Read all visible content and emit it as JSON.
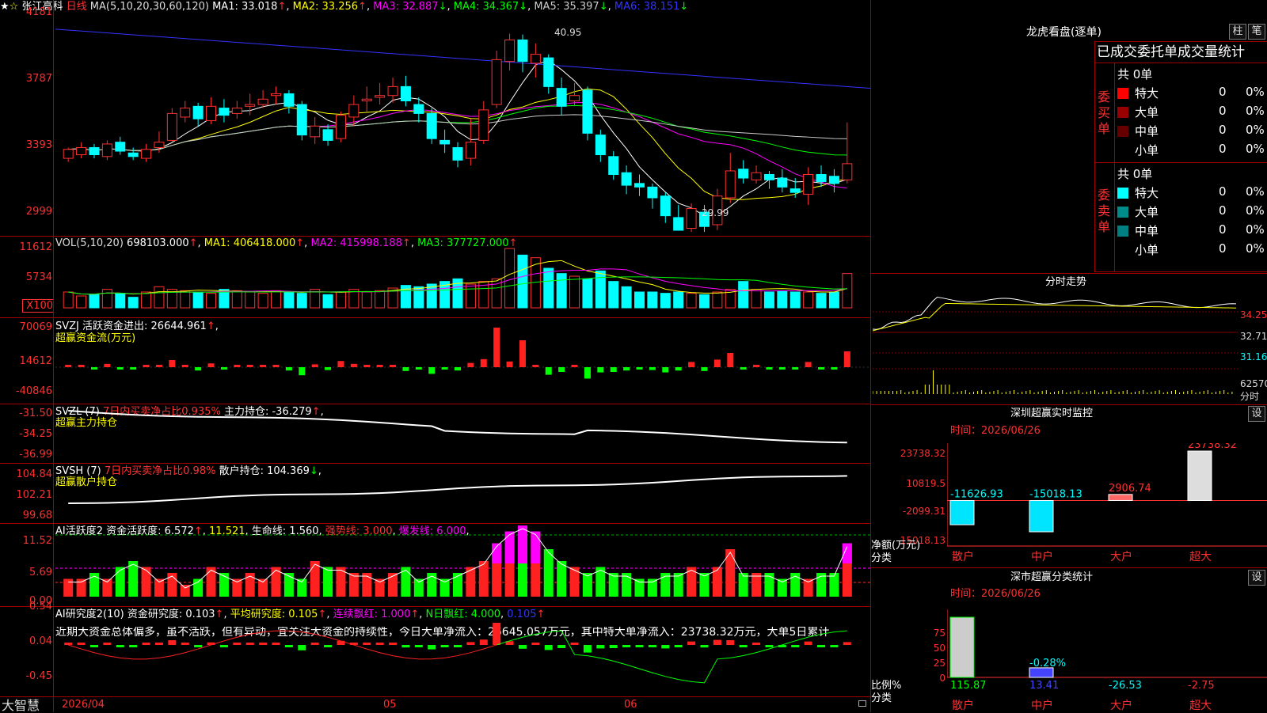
{
  "header": {
    "stock_name": "张江高科",
    "period": "日线",
    "ma_title": "MA(5,10,20,30,60,120)",
    "ma1": "MA1: 33.018",
    "ma2": "MA2: 33.256",
    "ma3": "MA3: 32.887",
    "ma4": "MA4: 34.367",
    "ma5": "MA5: 35.397",
    "ma6": "MA6: 38.151",
    "up": "↑",
    "down": "↓"
  },
  "price_axis": [
    "4181",
    "3787",
    "3393",
    "2999"
  ],
  "price_marks": {
    "high": "40.95",
    "low": "29.99"
  },
  "vol": {
    "title": "VOL(5,10,20)",
    "value": "698103.000",
    "ma1": "MA1: 406418.000",
    "ma2": "MA2: 415998.188",
    "ma3": "MA3: 377727.000",
    "axis": [
      "11612",
      "5734",
      "X100"
    ]
  },
  "svzj": {
    "line1": "SVZJ  活跃资金进出: 26644.961",
    "line2": "超赢资金流(万元)",
    "axis": [
      "70069",
      "14612",
      "-40846"
    ]
  },
  "svzl": {
    "prefix": "SVZL (7)",
    "mid": "7日内买卖净占比0.935%",
    "tail": "主力持仓: -36.279",
    "line2": "超赢主力持仓",
    "axis": [
      "-31.50",
      "-34.25",
      "-36.99"
    ]
  },
  "svsh": {
    "prefix": "SVSH (7)",
    "mid": "7日内买卖净占比0.98%",
    "tail": "散户持仓: 104.369",
    "line2": "超赢散户持仓",
    "axis": [
      "104.84",
      "102.21",
      "99.68"
    ]
  },
  "ai1": {
    "a": "AI活跃度2 资金活跃度: 6.572",
    "b": "11.521",
    "c": "生命线: 1.560",
    "d": "强势线: 3.000",
    "e": "爆发线: 6.000",
    "axis": [
      "11.52",
      "5.69",
      "0.00"
    ]
  },
  "ai2": {
    "a": "AI研究度2(10) 资金研究度: 0.103",
    "b": "平均研究度: 0.105",
    "c": "连续飘红: 1.000",
    "d": "N日飘红: 4.000",
    "e": "0.105",
    "comment": "近期大资金总体偏多，虽不活跃，但有异动，宜关注大资金的持续性，今日大单净流入：26645.057万元，其中特大单净流入：23738.32万元，大单5日累计",
    "axis": [
      "0.54",
      "0.04",
      "-0.45"
    ]
  },
  "date_axis": {
    "d1": "2026/04",
    "d2": "05",
    "d3": "06",
    "brand": "大智慧"
  },
  "right": {
    "lhkp_title": "龙虎看盘(逐单)",
    "btn1": "柱",
    "btn2": "笔",
    "stat_title": "已成交委托单成交量统计",
    "buy_label": "委买单",
    "sell_label": "委卖单",
    "buy_total": "共 0单",
    "sell_total": "共 0单",
    "buy_rows": [
      {
        "name": "特大",
        "n": "0",
        "p": "0%",
        "color": "#ff0000"
      },
      {
        "name": "大单",
        "n": "0",
        "p": "0%",
        "color": "#990000"
      },
      {
        "name": "中单",
        "n": "0",
        "p": "0%",
        "color": "#660000"
      },
      {
        "name": "小单",
        "n": "0",
        "p": "0%",
        "color": ""
      }
    ],
    "sell_rows": [
      {
        "name": "特大",
        "n": "0",
        "p": "0%",
        "color": "#00ffff"
      },
      {
        "name": "大单",
        "n": "0",
        "p": "0%",
        "color": "#008b8b"
      },
      {
        "name": "中单",
        "n": "0",
        "p": "0%",
        "color": "#008080"
      },
      {
        "name": "小单",
        "n": "0",
        "p": "0%",
        "color": ""
      }
    ],
    "intraday_title": "分时走势",
    "intraday_axis": [
      "34.25",
      "32.71",
      "31.16",
      "62570",
      "分时"
    ],
    "sz_title": "深圳超赢实时监控",
    "sz_gear": "设",
    "sz_time": "时间：2026/06/26",
    "sz_axis": [
      "23738.32",
      "10819.5",
      "-2099.31",
      "-15018.13"
    ],
    "sz_ylabel": "净额(万元)",
    "sz_xlabel": "分类",
    "sz_bars": [
      {
        "cat": "散户",
        "value": "-11626.93"
      },
      {
        "cat": "中户",
        "value": "-15018.13"
      },
      {
        "cat": "大户",
        "value": "2906.74"
      },
      {
        "cat": "超大",
        "value": "23738.32"
      }
    ],
    "cls_title": "深市超赢分类统计",
    "cls_gear": "设",
    "cls_time": "时间：2026/06/26",
    "cls_axis": [
      "75",
      "50",
      "25",
      "0"
    ],
    "cls_ylabel": "比例%",
    "cls_xlabel": "分类",
    "cls_bars": [
      {
        "cat": "散户",
        "value": "115.87"
      },
      {
        "cat": "中户",
        "value": "13.41"
      },
      {
        "cat": "大户",
        "value": "-26.53"
      },
      {
        "cat": "超大",
        "value": "-2.75"
      }
    ],
    "cls_mid_label": "-0.28%"
  },
  "chart_data": {
    "type": "candlestick",
    "candles": [
      [
        34.0,
        34.5,
        33.8,
        34.6
      ],
      [
        34.2,
        34.6,
        34.0,
        34.9
      ],
      [
        34.6,
        34.2,
        34.0,
        34.8
      ],
      [
        34.1,
        34.8,
        33.9,
        35.0
      ],
      [
        34.9,
        34.4,
        34.2,
        35.2
      ],
      [
        34.3,
        34.1,
        33.9,
        34.6
      ],
      [
        34.0,
        34.5,
        33.8,
        34.8
      ],
      [
        34.6,
        34.9,
        34.3,
        35.5
      ],
      [
        35.0,
        36.5,
        34.9,
        36.8
      ],
      [
        36.3,
        36.8,
        36.0,
        37.2
      ],
      [
        36.9,
        36.2,
        35.8,
        37.1
      ],
      [
        36.1,
        36.9,
        35.9,
        37.4
      ],
      [
        36.8,
        36.4,
        36.0,
        37.3
      ],
      [
        36.5,
        36.8,
        36.2,
        37.2
      ],
      [
        36.9,
        37.0,
        36.4,
        37.6
      ],
      [
        37.0,
        37.3,
        36.8,
        37.8
      ],
      [
        37.5,
        37.6,
        37.0,
        38.0
      ],
      [
        37.6,
        36.9,
        36.5,
        37.8
      ],
      [
        37.0,
        35.3,
        35.0,
        37.2
      ],
      [
        35.2,
        35.8,
        34.8,
        36.3
      ],
      [
        35.6,
        35.0,
        34.7,
        35.9
      ],
      [
        35.1,
        36.4,
        34.9,
        36.6
      ],
      [
        36.3,
        37.0,
        35.8,
        37.5
      ],
      [
        37.2,
        37.3,
        36.6,
        38.0
      ],
      [
        37.4,
        37.5,
        37.0,
        38.2
      ],
      [
        37.5,
        38.0,
        37.1,
        38.5
      ],
      [
        38.0,
        37.2,
        36.9,
        38.6
      ],
      [
        37.0,
        36.5,
        36.0,
        37.4
      ],
      [
        36.5,
        35.1,
        34.8,
        36.8
      ],
      [
        35.0,
        34.8,
        34.3,
        35.6
      ],
      [
        34.6,
        33.9,
        33.5,
        34.9
      ],
      [
        34.0,
        34.9,
        33.6,
        36.2
      ],
      [
        35.0,
        36.7,
        34.8,
        37.2
      ],
      [
        37.0,
        39.5,
        36.8,
        40.0
      ],
      [
        39.4,
        40.6,
        38.9,
        40.95
      ],
      [
        40.6,
        39.4,
        38.8,
        40.9
      ],
      [
        39.3,
        39.8,
        38.5,
        40.4
      ],
      [
        39.6,
        38.0,
        37.6,
        39.8
      ],
      [
        37.9,
        36.9,
        36.4,
        38.5
      ],
      [
        37.2,
        37.5,
        36.9,
        38.2
      ],
      [
        37.8,
        35.4,
        35.0,
        38.0
      ],
      [
        35.3,
        34.2,
        33.8,
        35.6
      ],
      [
        34.1,
        33.1,
        32.8,
        34.4
      ],
      [
        33.2,
        32.5,
        32.0,
        33.6
      ],
      [
        32.6,
        32.4,
        31.9,
        33.1
      ],
      [
        32.4,
        31.8,
        31.2,
        32.6
      ],
      [
        31.9,
        30.8,
        30.4,
        32.1
      ],
      [
        30.7,
        29.99,
        29.99,
        31.4
      ],
      [
        30.1,
        31.2,
        29.9,
        31.5
      ],
      [
        31.0,
        30.2,
        29.9,
        31.4
      ],
      [
        30.3,
        31.9,
        30.0,
        32.3
      ],
      [
        31.8,
        33.3,
        31.5,
        34.3
      ],
      [
        33.4,
        32.9,
        32.6,
        33.9
      ],
      [
        32.8,
        33.2,
        32.6,
        33.6
      ],
      [
        33.1,
        32.8,
        32.3,
        33.3
      ],
      [
        32.9,
        32.4,
        32.1,
        33.4
      ],
      [
        32.3,
        32.1,
        31.8,
        32.9
      ],
      [
        32.0,
        33.1,
        31.4,
        33.5
      ],
      [
        33.1,
        32.7,
        32.4,
        33.6
      ],
      [
        33.0,
        32.6,
        32.1,
        33.4
      ],
      [
        32.8,
        33.7,
        32.6,
        36.0
      ]
    ],
    "price_ylim": [
      29.99,
      41.81
    ],
    "volume_ylim": [
      0,
      11612
    ]
  }
}
